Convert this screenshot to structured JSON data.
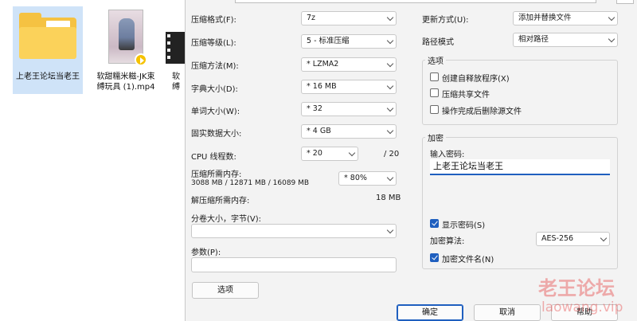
{
  "desktop": {
    "files": [
      {
        "label": "上老王论坛当老王",
        "icon": "folder-icon",
        "selected": true
      },
      {
        "label_line1": "软甜糯米糍-JK束",
        "label_line2": "缚玩具 (1).mp4",
        "icon": "video-thumbnail-icon"
      },
      {
        "label_line1": "软",
        "label_line2": "缚",
        "icon": "film-icon"
      }
    ]
  },
  "settings": {
    "archive_format": {
      "label": "压缩格式(F):",
      "value": "7z"
    },
    "compression_level": {
      "label": "压缩等级(L):",
      "value": "5 - 标准压缩"
    },
    "compression_method": {
      "label": "压缩方法(M):",
      "value": "* LZMA2"
    },
    "dictionary_size": {
      "label": "字典大小(D):",
      "value": "* 16 MB"
    },
    "word_size": {
      "label": "单词大小(W):",
      "value": "* 32"
    },
    "solid_block_size": {
      "label": "固实数据大小:",
      "value": "* 4 GB"
    },
    "cpu_threads": {
      "label": "CPU 线程数:",
      "value": "* 20",
      "max": "/ 20"
    },
    "memory_compress": {
      "label": "压缩所需内存:",
      "detail": "3088 MB / 12871 MB / 16089 MB",
      "value": "* 80%"
    },
    "memory_decompress": {
      "label": "解压缩所需内存:",
      "value": "18 MB"
    },
    "split_volumes": {
      "label": "分卷大小，字节(V):",
      "value": ""
    },
    "parameters": {
      "label": "参数(P):",
      "value": ""
    },
    "options_button": "选项"
  },
  "right": {
    "update_mode": {
      "label": "更新方式(U):",
      "value": "添加并替换文件"
    },
    "path_mode": {
      "label": "路径模式",
      "value": "相对路径"
    },
    "options_group": {
      "title": "选项",
      "items": [
        {
          "label": "创建自释放程序(X)",
          "checked": false
        },
        {
          "label": "压缩共享文件",
          "checked": false
        },
        {
          "label": "操作完成后删除源文件",
          "checked": false
        }
      ]
    },
    "encryption_group": {
      "title": "加密",
      "password_label": "输入密码:",
      "password_value": "上老王论坛当老王",
      "show_password": {
        "label": "显示密码(S)",
        "checked": true
      },
      "method": {
        "label": "加密算法:",
        "value": "AES-256"
      },
      "encrypt_names": {
        "label": "加密文件名(N)",
        "checked": true
      }
    }
  },
  "buttons": {
    "ok": "确定",
    "cancel": "取消",
    "help": "帮助"
  },
  "watermark": {
    "line1": "老王论坛",
    "line2": "laowang.vip",
    "color": "#e65050"
  }
}
